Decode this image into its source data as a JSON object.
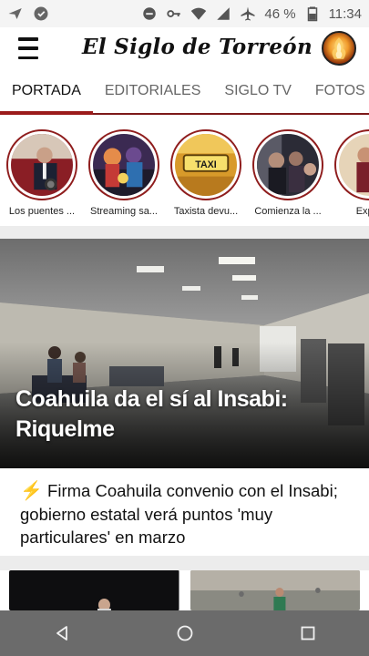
{
  "status_bar": {
    "battery_percent": "46 %",
    "time": "11:34",
    "icons": [
      "send-icon",
      "ci-app-icon",
      "minus-circle-icon",
      "key-icon",
      "wifi-icon",
      "signal-icon",
      "airplane-icon",
      "battery-icon"
    ]
  },
  "header": {
    "logo_text": "El Siglo de Torreón",
    "menu_icon": "hamburger-menu-icon",
    "avatar_icon": "profile-avatar"
  },
  "tabs": [
    {
      "label": "PORTADA",
      "active": true
    },
    {
      "label": "EDITORIALES",
      "active": false
    },
    {
      "label": "SIGLO TV",
      "active": false
    },
    {
      "label": "FOTOS",
      "active": false
    }
  ],
  "stories": [
    {
      "label": "Los puentes ..."
    },
    {
      "label": "Streaming sa..."
    },
    {
      "label": "Taxista devu..."
    },
    {
      "label": "Comienza la ..."
    },
    {
      "label": "Explot"
    }
  ],
  "taxi_sign_text": "TAXI",
  "hero": {
    "title": "Coahuila da el sí al Insabi: Riquelme"
  },
  "related": {
    "icon": "lightning-bolt-icon",
    "text": "Firma Coahuila convenio con el Insabi; gobierno estatal verá puntos 'muy particulares' en marzo"
  },
  "colors": {
    "accent": "#9b1b1b",
    "bolt": "#f2c21b",
    "nav_bar": "#6b6b6b"
  },
  "nav": {
    "back_icon": "back-triangle-icon",
    "home_icon": "home-circle-icon",
    "recents_icon": "recents-square-icon"
  }
}
